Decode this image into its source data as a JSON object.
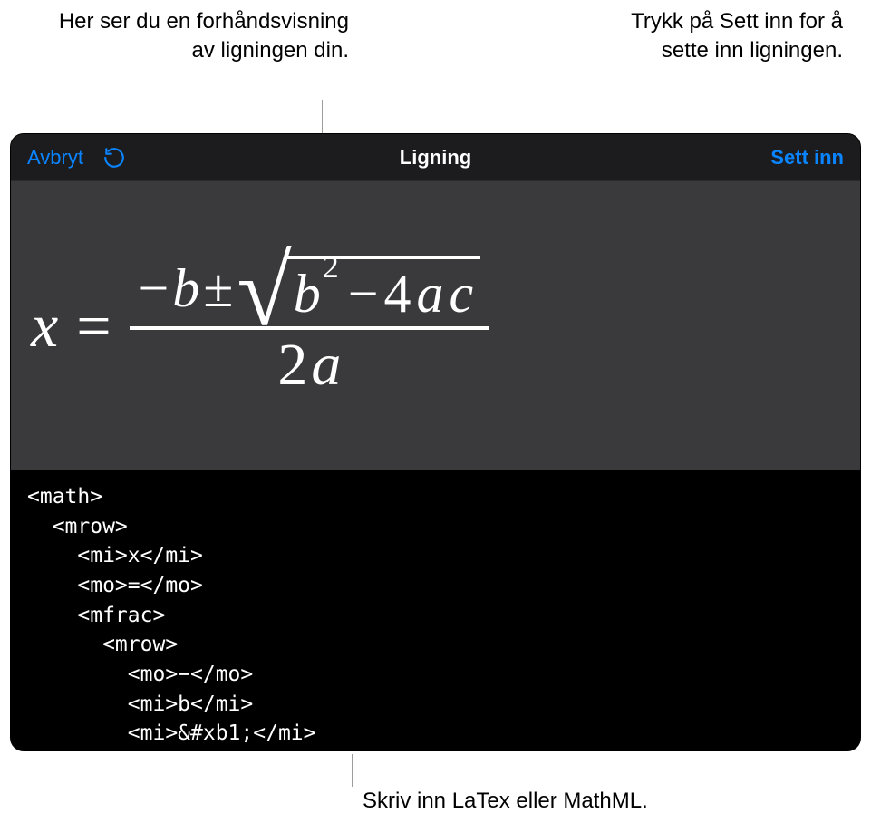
{
  "callouts": {
    "preview": "Her ser du en forhåndsvisning av ligningen din.",
    "insert": "Trykk på Sett inn for å sette inn ligningen.",
    "input": "Skriv inn LaTex eller MathML."
  },
  "navbar": {
    "cancel": "Avbryt",
    "title": "Ligning",
    "insert": "Sett inn"
  },
  "equation": {
    "x": "x",
    "equals": "=",
    "minus": "−",
    "b": "b",
    "pm": "±",
    "b2": "b",
    "sq": "2",
    "minus2": "−",
    "four": "4",
    "a": "a",
    "c": "c",
    "two": "2",
    "a2": "a"
  },
  "code": "<math>\n  <mrow>\n    <mi>x</mi>\n    <mo>=</mo>\n    <mfrac>\n      <mrow>\n        <mo>−</mo>\n        <mi>b</mi>\n        <mi>&#xb1;</mi>"
}
